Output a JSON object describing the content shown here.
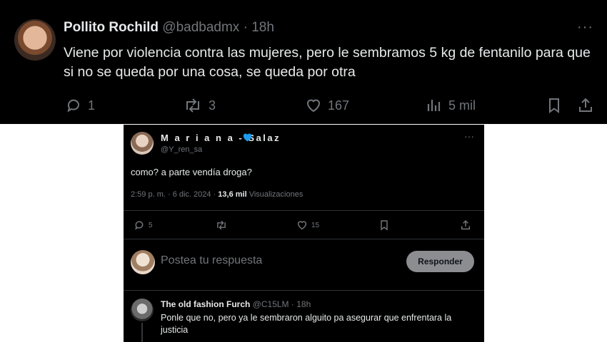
{
  "main_tweet": {
    "display_name": "Pollito Rochild",
    "handle": "@badbadmx",
    "separator": "·",
    "time": "18h",
    "more_label": "···",
    "text": "Viene por violencia contra las mujeres, pero le sembramos 5 kg de fentanilo para que si no se queda por una cosa, se queda por otra",
    "actions": {
      "replies": "1",
      "reposts": "3",
      "likes": "167",
      "views": "5 mil"
    },
    "icons": [
      "reply-icon",
      "repost-icon",
      "like-icon",
      "views-icon",
      "bookmark-icon",
      "share-icon"
    ]
  },
  "reply_card": {
    "display_name": "M a r i a n a - Salaz",
    "handle": "@Y_ren_sa",
    "more_label": "···",
    "text": "como? a parte vendía droga?",
    "meta": {
      "datetime": "2:59 p. m. · 6 dic. 2024 · ",
      "views_count": "13,6 mil",
      "views_label": " Visualizaciones"
    },
    "actions": {
      "replies": "5",
      "likes": "15"
    },
    "verified_color": "#1d9bf0"
  },
  "compose": {
    "placeholder": "Postea tu respuesta",
    "button_label": "Responder"
  },
  "thread_reply": {
    "display_name": "The old fashion Furch",
    "handle": "@C15LM",
    "separator": " · ",
    "time": "18h",
    "text": "Ponle que no, pero ya le sembraron alguito pa asegurar que enfrentara la justicia"
  }
}
